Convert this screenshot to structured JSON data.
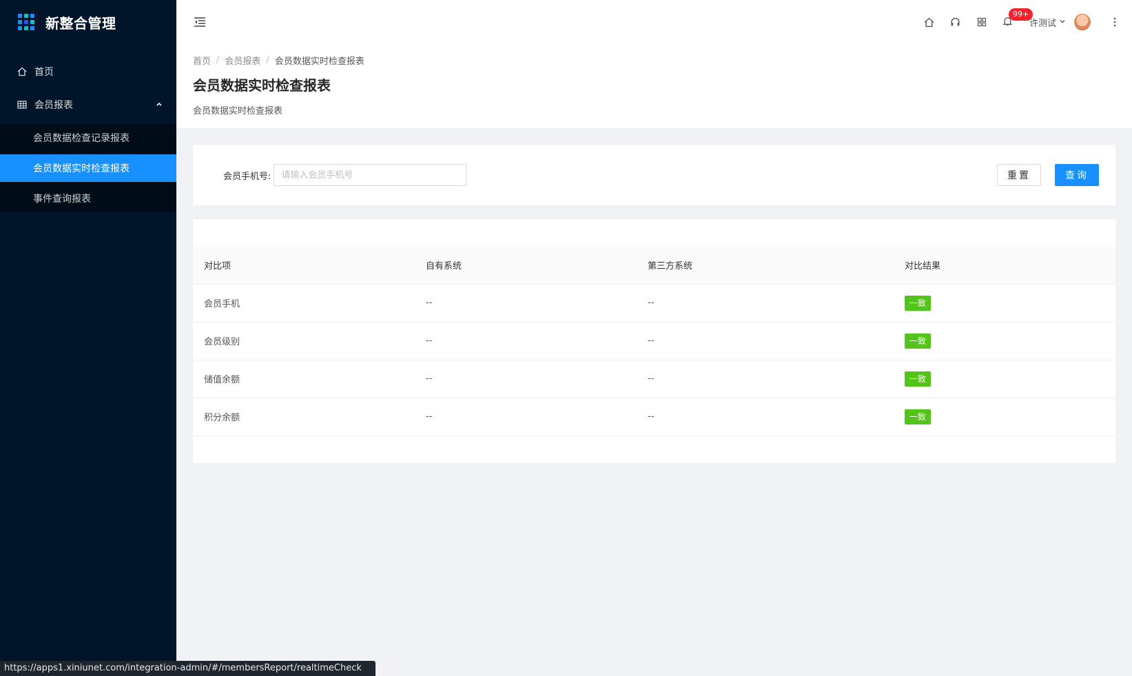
{
  "app": {
    "title": "新整合管理",
    "icon": "app-grid-icon"
  },
  "sidebar": {
    "items": [
      {
        "label": "首页",
        "icon": "home-icon"
      },
      {
        "label": "会员报表",
        "icon": "table-icon",
        "expanded": true,
        "children": [
          {
            "label": "会员数据检查记录报表"
          },
          {
            "label": "会员数据实时检查报表",
            "active": true
          },
          {
            "label": "事件查询报表"
          }
        ]
      }
    ]
  },
  "header": {
    "icons": [
      "home-icon",
      "headset-icon",
      "apps-icon",
      "bell-icon"
    ],
    "notification_count": "99+",
    "user_name": "许测试"
  },
  "breadcrumb": [
    "首页",
    "会员报表",
    "会员数据实时检查报表"
  ],
  "page": {
    "title": "会员数据实时检查报表",
    "description": "会员数据实时检查报表"
  },
  "search": {
    "label": "会员手机号:",
    "value": "",
    "placeholder": "请输入会员手机号",
    "reset_label": "重置",
    "query_label": "查询"
  },
  "table": {
    "columns": [
      "对比项",
      "自有系统",
      "第三方系统",
      "对比结果"
    ],
    "rows": [
      {
        "item": "会员手机",
        "own": "--",
        "third": "--",
        "result": "一致"
      },
      {
        "item": "会员级别",
        "own": "--",
        "third": "--",
        "result": "一致"
      },
      {
        "item": "储值余额",
        "own": "--",
        "third": "--",
        "result": "一致"
      },
      {
        "item": "积分余额",
        "own": "--",
        "third": "--",
        "result": "一致"
      }
    ]
  },
  "status_url": "https://apps1.xiniunet.com/integration-admin/#/membersReport/realtimeCheck",
  "colors": {
    "primary": "#1890ff",
    "sidebar_bg": "#001529",
    "success": "#52c41a",
    "badge": "#f5222d"
  }
}
